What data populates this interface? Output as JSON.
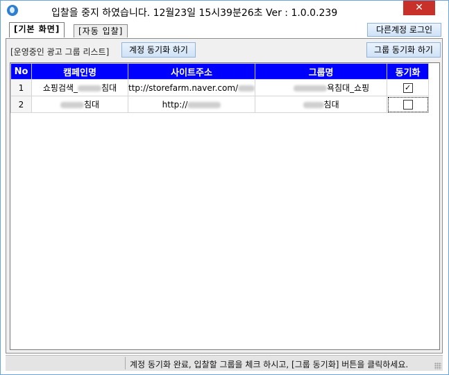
{
  "window": {
    "title": "입찰을 중지 하였습니다. 12월23일 15시39분26초 Ver : 1.0.0.239",
    "close_glyph": "✕"
  },
  "tabs": [
    {
      "label": "[기본 화면]",
      "active": true
    },
    {
      "label": "[자동 입찰]",
      "active": false
    }
  ],
  "buttons": {
    "other_account_login": "다른계정 로그인",
    "account_sync": "계정 동기화 하기",
    "group_sync": "그룹 동기화 하기"
  },
  "list_label": "[운영중인 광고 그룹 리스트]",
  "table": {
    "headers": [
      "No",
      "캠페인명",
      "사이트주소",
      "그룹명",
      "동기화"
    ],
    "rows": [
      {
        "no": "1",
        "campaign_prefix": "쇼핑검색_",
        "campaign_suffix": "침대",
        "site_prefix": "ttp://storefarm.naver.com/",
        "group_suffix": "욕침대_쇼핑",
        "synced": true
      },
      {
        "no": "2",
        "campaign_prefix": "",
        "campaign_suffix": "침대",
        "site_prefix": "http://",
        "group_suffix": "침대",
        "synced": false
      }
    ]
  },
  "status": {
    "message": "계정 동기화 완료, 입찰할 그룹을 체크 하시고, [그룹 동기화] 버튼을 클릭하세요."
  },
  "colors": {
    "header_bg": "#0000ff",
    "accent_border": "#6aa3d9",
    "close_bg": "#c7312a"
  }
}
